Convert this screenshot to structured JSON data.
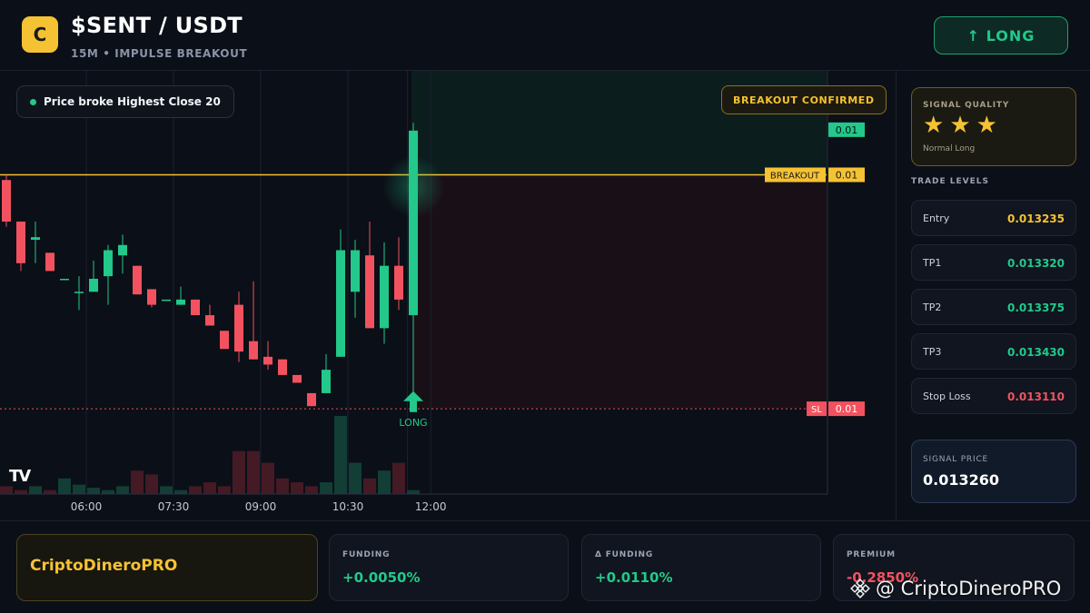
{
  "header": {
    "logo_letter": "C",
    "pair": "$SENT / USDT",
    "subtitle": "15M • IMPULSE BREAKOUT",
    "signal_button": "↑ LONG"
  },
  "chart": {
    "annotation": "Price broke Highest Close 20",
    "confirm_badge": "BREAKOUT CONFIRMED",
    "tv_logo": "TV",
    "long_marker": "LONG",
    "price_tags": {
      "top": "0.01",
      "breakout_label": "BREAKOUT",
      "breakout": "0.01",
      "sl_label": "SL",
      "sl": "0.01"
    },
    "time_labels": [
      "06:00",
      "07:30",
      "09:00",
      "10:30",
      "12:00"
    ]
  },
  "chart_data": {
    "type": "candlestick",
    "x_tick_labels": [
      "06:00",
      "07:30",
      "09:00",
      "10:30",
      "12:00"
    ],
    "candles": [
      {
        "o": 0.013268,
        "h": 0.01327,
        "l": 0.01325,
        "c": 0.013252
      },
      {
        "o": 0.013252,
        "h": 0.013252,
        "l": 0.013233,
        "c": 0.013236
      },
      {
        "o": 0.013245,
        "h": 0.013252,
        "l": 0.013236,
        "c": 0.013246
      },
      {
        "o": 0.01324,
        "h": 0.01324,
        "l": 0.013233,
        "c": 0.013233
      },
      {
        "o": 0.01323,
        "h": 0.01323,
        "l": 0.01323,
        "c": 0.01323
      },
      {
        "o": 0.013225,
        "h": 0.013231,
        "l": 0.013218,
        "c": 0.013225
      },
      {
        "o": 0.013225,
        "h": 0.013237,
        "l": 0.013225,
        "c": 0.01323
      },
      {
        "o": 0.013231,
        "h": 0.013243,
        "l": 0.01322,
        "c": 0.013241
      },
      {
        "o": 0.013239,
        "h": 0.013247,
        "l": 0.013232,
        "c": 0.013243
      },
      {
        "o": 0.013235,
        "h": 0.013235,
        "l": 0.013224,
        "c": 0.013224
      },
      {
        "o": 0.013226,
        "h": 0.013226,
        "l": 0.013219,
        "c": 0.01322
      },
      {
        "o": 0.013222,
        "h": 0.013222,
        "l": 0.013222,
        "c": 0.013222
      },
      {
        "o": 0.01322,
        "h": 0.013227,
        "l": 0.01322,
        "c": 0.013222
      },
      {
        "o": 0.013222,
        "h": 0.013222,
        "l": 0.013216,
        "c": 0.013216
      },
      {
        "o": 0.013216,
        "h": 0.01322,
        "l": 0.013212,
        "c": 0.013212
      },
      {
        "o": 0.01321,
        "h": 0.01321,
        "l": 0.013203,
        "c": 0.013203
      },
      {
        "o": 0.01322,
        "h": 0.013225,
        "l": 0.013198,
        "c": 0.013202
      },
      {
        "o": 0.013206,
        "h": 0.013229,
        "l": 0.013199,
        "c": 0.013199
      },
      {
        "o": 0.0132,
        "h": 0.013206,
        "l": 0.013195,
        "c": 0.013197
      },
      {
        "o": 0.013199,
        "h": 0.013199,
        "l": 0.013193,
        "c": 0.013193
      },
      {
        "o": 0.013193,
        "h": 0.013193,
        "l": 0.01319,
        "c": 0.01319
      },
      {
        "o": 0.013186,
        "h": 0.013186,
        "l": 0.013181,
        "c": 0.013181
      },
      {
        "o": 0.013186,
        "h": 0.013201,
        "l": 0.013186,
        "c": 0.013195
      },
      {
        "o": 0.0132,
        "h": 0.013249,
        "l": 0.0132,
        "c": 0.013241
      },
      {
        "o": 0.013225,
        "h": 0.013245,
        "l": 0.013215,
        "c": 0.013241
      },
      {
        "o": 0.013239,
        "h": 0.013252,
        "l": 0.013215,
        "c": 0.013211
      },
      {
        "o": 0.013211,
        "h": 0.013244,
        "l": 0.013205,
        "c": 0.013235
      },
      {
        "o": 0.013235,
        "h": 0.013246,
        "l": 0.013218,
        "c": 0.013222
      },
      {
        "o": 0.013216,
        "h": 0.01329,
        "l": 0.013185,
        "c": 0.013287
      }
    ],
    "volume_relative": [
      0.1,
      0.05,
      0.1,
      0.05,
      0.2,
      0.12,
      0.08,
      0.05,
      0.1,
      0.3,
      0.25,
      0.1,
      0.05,
      0.1,
      0.15,
      0.1,
      0.55,
      0.55,
      0.4,
      0.2,
      0.15,
      0.1,
      0.15,
      1.0,
      0.4,
      0.2,
      0.3,
      0.4,
      0.05
    ],
    "breakout_level": 0.01327,
    "stop_loss_level": 0.01318,
    "y_range": [
      0.013172,
      0.01331
    ],
    "legend": "none",
    "grid": true
  },
  "sidebar": {
    "quality_label": "SIGNAL QUALITY",
    "stars": 3,
    "quality_sub": "Normal Long",
    "levels_title": "TRADE LEVELS",
    "levels": [
      {
        "name": "Entry",
        "value": "0.013235",
        "color": "#f5c233"
      },
      {
        "name": "TP1",
        "value": "0.013320",
        "color": "#22c98a"
      },
      {
        "name": "TP2",
        "value": "0.013375",
        "color": "#22c98a"
      },
      {
        "name": "TP3",
        "value": "0.013430",
        "color": "#22c98a"
      },
      {
        "name": "Stop Loss",
        "value": "0.013110",
        "color": "#f2525f"
      }
    ],
    "signal_price_label": "SIGNAL PRICE",
    "signal_price": "0.013260"
  },
  "footer": {
    "brand": "CriptoDineroPRO",
    "stats": [
      {
        "label": "FUNDING",
        "value": "+0.0050%",
        "color": "#22c98a"
      },
      {
        "label": "Δ FUNDING",
        "value": "+0.0110%",
        "color": "#22c98a"
      },
      {
        "label": "PREMIUM",
        "value": "-0.2850%",
        "color": "#f2525f"
      }
    ],
    "watermark": "@ CriptoDineroPRO"
  },
  "colors": {
    "up": "#22c98a",
    "down": "#f2525f",
    "accent": "#f5c233",
    "background": "#0b0f17"
  }
}
